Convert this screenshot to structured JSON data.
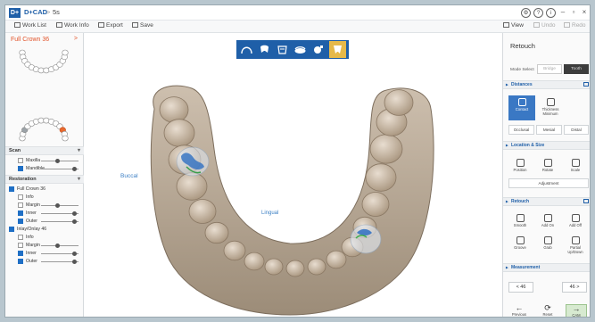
{
  "app": {
    "logo_text": "D+",
    "title": "D+CAD",
    "separator": ">",
    "document": "5s"
  },
  "titlebar_icons": [
    "⚙",
    "?",
    "i"
  ],
  "window_controls": {
    "minimize": "–",
    "maximize": "▫",
    "close": "×"
  },
  "toolbar": {
    "work_list": "Work List",
    "work_info": "Work Info",
    "export": "Export",
    "save": "Save",
    "view": "View",
    "undo": "Undo",
    "redo": "Redo"
  },
  "left_panel": {
    "title": "Full Crown 36",
    "arrow": ">",
    "scan_header": "Scan",
    "scan_items": [
      {
        "label": "Maxilla",
        "checked": false,
        "level": 0.45
      },
      {
        "label": "Mandible",
        "checked": true,
        "level": 0.9
      }
    ],
    "restoration_header": "Restoration",
    "groups": [
      {
        "name": "Full Crown 36",
        "items": [
          {
            "label": "Info",
            "checked": false,
            "level": null
          },
          {
            "label": "Margin",
            "checked": false,
            "level": 0.45
          },
          {
            "label": "Inner",
            "checked": true,
            "level": 0.9
          },
          {
            "label": "Outer",
            "checked": true,
            "level": 0.9
          }
        ]
      },
      {
        "name": "Inlay/Onlay 46",
        "items": [
          {
            "label": "Info",
            "checked": false,
            "level": null
          },
          {
            "label": "Margin",
            "checked": false,
            "level": 0.45
          },
          {
            "label": "Inner",
            "checked": true,
            "level": 0.9
          },
          {
            "label": "Outer",
            "checked": true,
            "level": 0.9
          }
        ]
      }
    ]
  },
  "viewport": {
    "buccal": "Buccal",
    "lingual": "Lingual"
  },
  "tool_strip": [
    "arch-icon",
    "tooth-icon",
    "crown-icon",
    "gingiva-icon",
    "camera-icon",
    "jaw-icon"
  ],
  "right_panel": {
    "title": "Retouch",
    "mode_select_label": "Mode Select",
    "mode_bridge": "Bridge",
    "mode_tooth": "Tooth",
    "distances_header": "Distances",
    "distance_buttons": [
      "Contact",
      "Thickness Minimum"
    ],
    "distance_flat": [
      "Occlusal",
      "Mesial",
      "Distal"
    ],
    "location_header": "Location & Size",
    "location_buttons": [
      "Position",
      "Rotate",
      "Scale"
    ],
    "adjustment": "Adjustment",
    "retouch_header": "Retouch",
    "retouch_row1": [
      "Smooth",
      "Add On",
      "Add Off"
    ],
    "retouch_row2": [
      "Groove",
      "Grab",
      "Partial Up/Down"
    ],
    "measurement_header": "Measurement",
    "prev_tooth": "< 46",
    "next_tooth": "46 >",
    "previous": "Previous",
    "reset": "Reset",
    "cam": "CAM"
  }
}
